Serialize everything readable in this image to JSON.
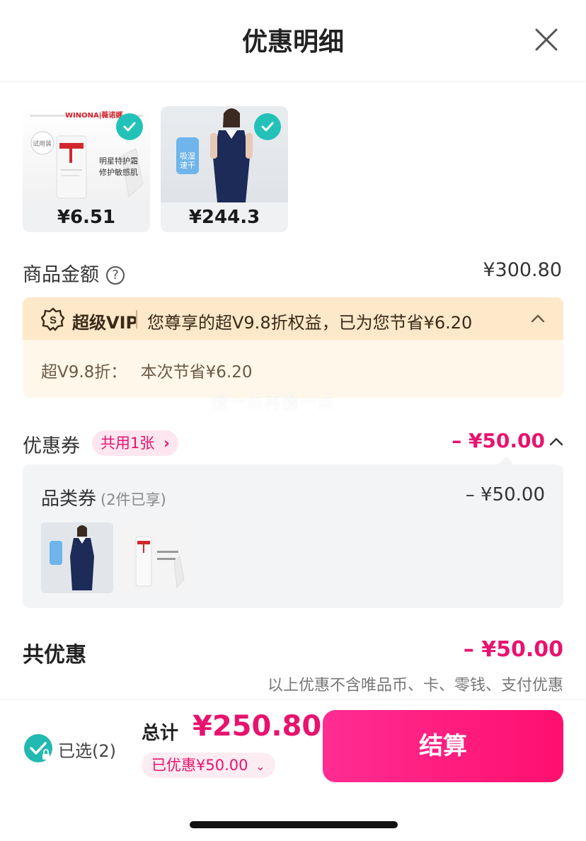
{
  "header": {
    "title": "优惠明细"
  },
  "products": [
    {
      "price": "¥6.51",
      "brand_logo": "WINONA|薇诺娜",
      "promo_line1": "明星特护霜",
      "promo_line2": "修护敏感肌",
      "tag": "试用装"
    },
    {
      "price": "¥244.3",
      "promo_line1": "吸湿",
      "promo_line2": "速干"
    }
  ],
  "goods_amount": {
    "label": "商品金额",
    "value": "¥300.80"
  },
  "vip": {
    "name": "超级VIP",
    "text": "您尊享的超V9.8折权益，已为您节省¥6.20",
    "detail_label": "超V9.8折：",
    "detail_value": "本次节省¥6.20"
  },
  "watermark": "慢一点再慢一点",
  "coupon": {
    "label": "优惠券",
    "chip": "共用1张",
    "value": "– ¥50.00",
    "category_label": "品类券",
    "category_sub": "(2件已享)",
    "category_value": "– ¥50.00"
  },
  "total_discount": {
    "label": "共优惠",
    "value": "– ¥50.00",
    "note": "以上优惠不含唯品币、卡、零钱、支付优惠"
  },
  "bottom": {
    "selected": "已选(2)",
    "sum_label": "总计",
    "sum_value": "¥250.80",
    "saved": "已优惠¥50.00",
    "pay": "结算"
  },
  "colors": {
    "accent": "#e8136e",
    "teal": "#22c2b8",
    "vip_bg": "#fde8c9"
  }
}
